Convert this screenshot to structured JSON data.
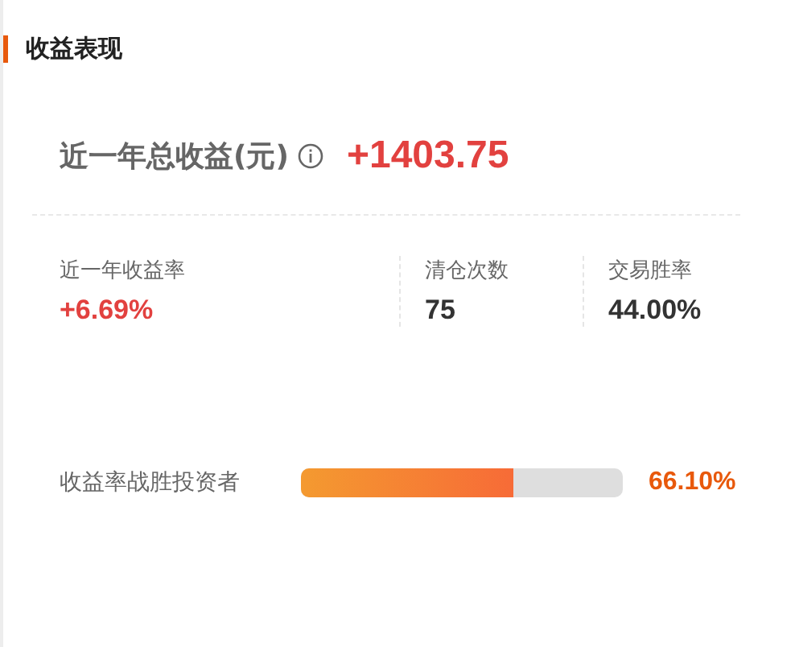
{
  "section": {
    "title": "收益表现"
  },
  "total": {
    "label": "近一年总收益(元)",
    "value": "+1403.75"
  },
  "stats": [
    {
      "label": "近一年收益率",
      "value": "+6.69%",
      "highlight": true
    },
    {
      "label": "清仓次数",
      "value": "75",
      "highlight": false
    },
    {
      "label": "交易胜率",
      "value": "44.00%",
      "highlight": false
    }
  ],
  "rank": {
    "label": "收益率战胜投资者",
    "level": 0.661,
    "reading": "66.10%"
  }
}
